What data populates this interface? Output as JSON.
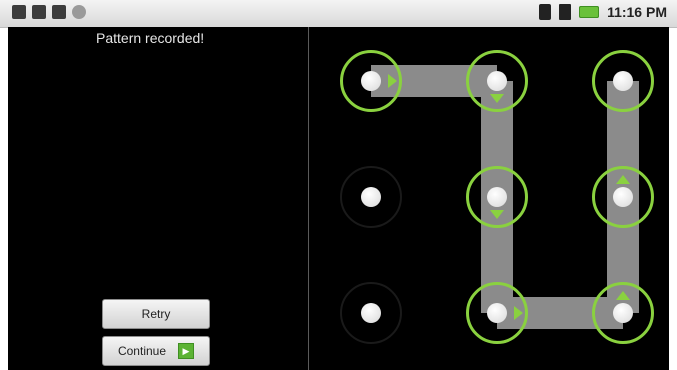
{
  "status_bar": {
    "left_icons": [
      "usb-icon",
      "sd-card-icon",
      "debug-icon",
      "record-icon"
    ],
    "right_icons": [
      "bluetooth-icon",
      "signal-icon",
      "battery-icon"
    ],
    "time": "11:16 PM"
  },
  "unlock": {
    "header": "Pattern recorded!",
    "retry_label": "Retry",
    "continue_label": "Continue"
  },
  "pattern": {
    "selected_dots": [
      1,
      2,
      5,
      8,
      9,
      6,
      3
    ],
    "ring_color": "#8ad13f"
  }
}
